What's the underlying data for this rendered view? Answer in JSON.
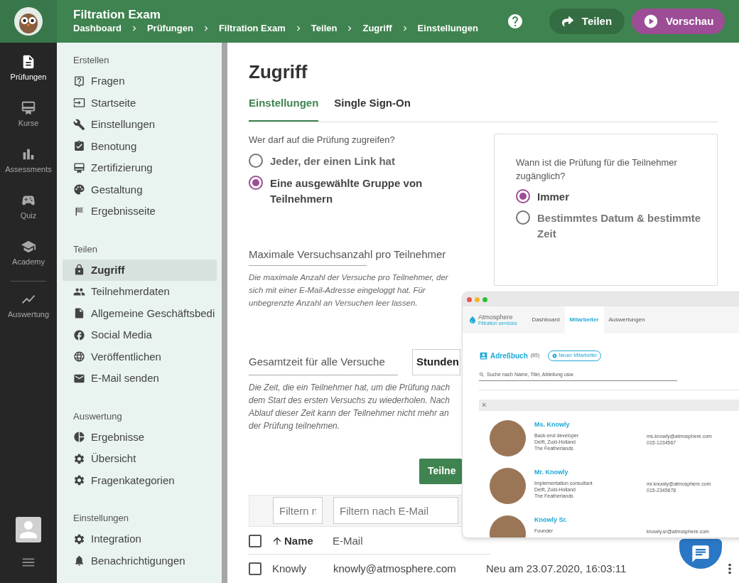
{
  "app_header": {
    "title": "Filtration Exam",
    "breadcrumbs": [
      "Dashboard",
      "Prüfungen",
      "Filtration Exam",
      "Teilen",
      "Zugriff",
      "Einstellungen"
    ],
    "share_button": "Teilen",
    "preview_button": "Vorschau"
  },
  "nav_rail": {
    "items": [
      {
        "label": "Prüfungen",
        "selected": true
      },
      {
        "label": "Kurse",
        "selected": false
      },
      {
        "label": "Assessments",
        "selected": false
      },
      {
        "label": "Quiz",
        "selected": false
      },
      {
        "label": "Academy",
        "selected": false
      },
      {
        "label": "Auswertung",
        "selected": false
      }
    ]
  },
  "sidebar": {
    "sections": [
      {
        "title": "Erstellen",
        "items": [
          {
            "label": "Fragen",
            "selected": false
          },
          {
            "label": "Startseite",
            "selected": false
          },
          {
            "label": "Einstellungen",
            "selected": false
          },
          {
            "label": "Benotung",
            "selected": false
          },
          {
            "label": "Zertifizierung",
            "selected": false
          },
          {
            "label": "Gestaltung",
            "selected": false
          },
          {
            "label": "Ergebnisseite",
            "selected": false
          }
        ]
      },
      {
        "title": "Teilen",
        "items": [
          {
            "label": "Zugriff",
            "selected": true
          },
          {
            "label": "Teilnehmerdaten",
            "selected": false
          },
          {
            "label": "Allgemeine Geschäftsbedi",
            "selected": false
          },
          {
            "label": "Social Media",
            "selected": false
          },
          {
            "label": "Veröffentlichen",
            "selected": false
          },
          {
            "label": "E-Mail senden",
            "selected": false
          }
        ]
      },
      {
        "title": "Auswertung",
        "items": [
          {
            "label": "Ergebnisse",
            "selected": false
          },
          {
            "label": "Übersicht",
            "selected": false
          },
          {
            "label": "Fragenkategorien",
            "selected": false
          }
        ]
      },
      {
        "title": "Einstellungen",
        "items": [
          {
            "label": "Integration",
            "selected": false
          },
          {
            "label": "Benachrichtigungen",
            "selected": false
          }
        ]
      }
    ]
  },
  "page": {
    "title": "Zugriff",
    "tabs": [
      {
        "label": "Einstellungen",
        "selected": true
      },
      {
        "label": "Single Sign-On",
        "selected": false
      }
    ]
  },
  "access": {
    "question": "Wer darf auf die Prüfung zugreifen?",
    "options": [
      {
        "label": "Jeder, der einen Link hat",
        "selected": false
      },
      {
        "label": "Eine ausgewählte Gruppe von Teilnehmern",
        "selected": true
      }
    ]
  },
  "availability": {
    "question": "Wann ist die Prüfung für die Teilnehmer zugänglich?",
    "options": [
      {
        "label": "Immer",
        "selected": true
      },
      {
        "label": "Bestimmtes Datum & bestimmte Zeit",
        "selected": false
      }
    ]
  },
  "max_attempts": {
    "label": "Maximale Versuchsanzahl pro Teilnehmer",
    "help": "Die maximale Anzahl der Versuche pro Teilnehmer, der sich mit einer E-Mail-Adresse eingeloggt hat. Für unbegrenzte Anzahl an Versuchen leer lassen."
  },
  "total_time": {
    "label": "Gesamtzeit für alle Versuche",
    "unit": "Stunden",
    "help": "Die Zeit, die ein Teilnehmer hat, um die Prüfung nach dem Start des ersten Versuchs zu wiederholen. Nach Ablauf dieser Zeit kann der Teilnehmer nicht mehr an der Prüfung teilnehmen."
  },
  "participants_button": "Teilne",
  "filters": [
    {
      "placeholder": "Filtern n"
    },
    {
      "placeholder": "Filtern nach E-Mail"
    }
  ],
  "table": {
    "all_checked": false,
    "columns": [
      {
        "label": "Name",
        "sorted": true
      },
      {
        "label": "E-Mail",
        "sorted": false
      }
    ],
    "rows": [
      {
        "checked": false,
        "name": "Knowly",
        "email": "knowly@atmosphere.com",
        "status": "Neu am 23.07.2020, 16:03:11"
      }
    ]
  },
  "embedded_screenshot": {
    "brand": "Atmosphere",
    "tagline": "Filtration services",
    "tabs": [
      {
        "label": "Dashboard",
        "selected": false
      },
      {
        "label": "Mitarbeiter",
        "selected": true
      },
      {
        "label": "Auswertungen",
        "selected": false
      }
    ],
    "heading": "Adreßbuch",
    "count": "(85)",
    "new_button": "Neuer Mitarbeiter",
    "search_placeholder": "Suche nach Name, Titel, Abteilung usw.",
    "group": "K",
    "people": [
      {
        "name": "Ms. Knowly",
        "title": "Back-end developer",
        "city": "Delft, Zuid-Holland",
        "country": "The Featherlands",
        "email": "ms.knowly@atmosphere.com",
        "phone": "015-1234567"
      },
      {
        "name": "Mr. Knowly",
        "title": "Implementation consultant",
        "city": "Delft, Zuid-Holland",
        "country": "The Featherlands",
        "email": "mr.knowly@atmosphere.com",
        "phone": "015-2345678"
      },
      {
        "name": "Knowly Sr.",
        "title": "Founder",
        "email": "knowly.sr@atmosphere.com"
      }
    ]
  }
}
